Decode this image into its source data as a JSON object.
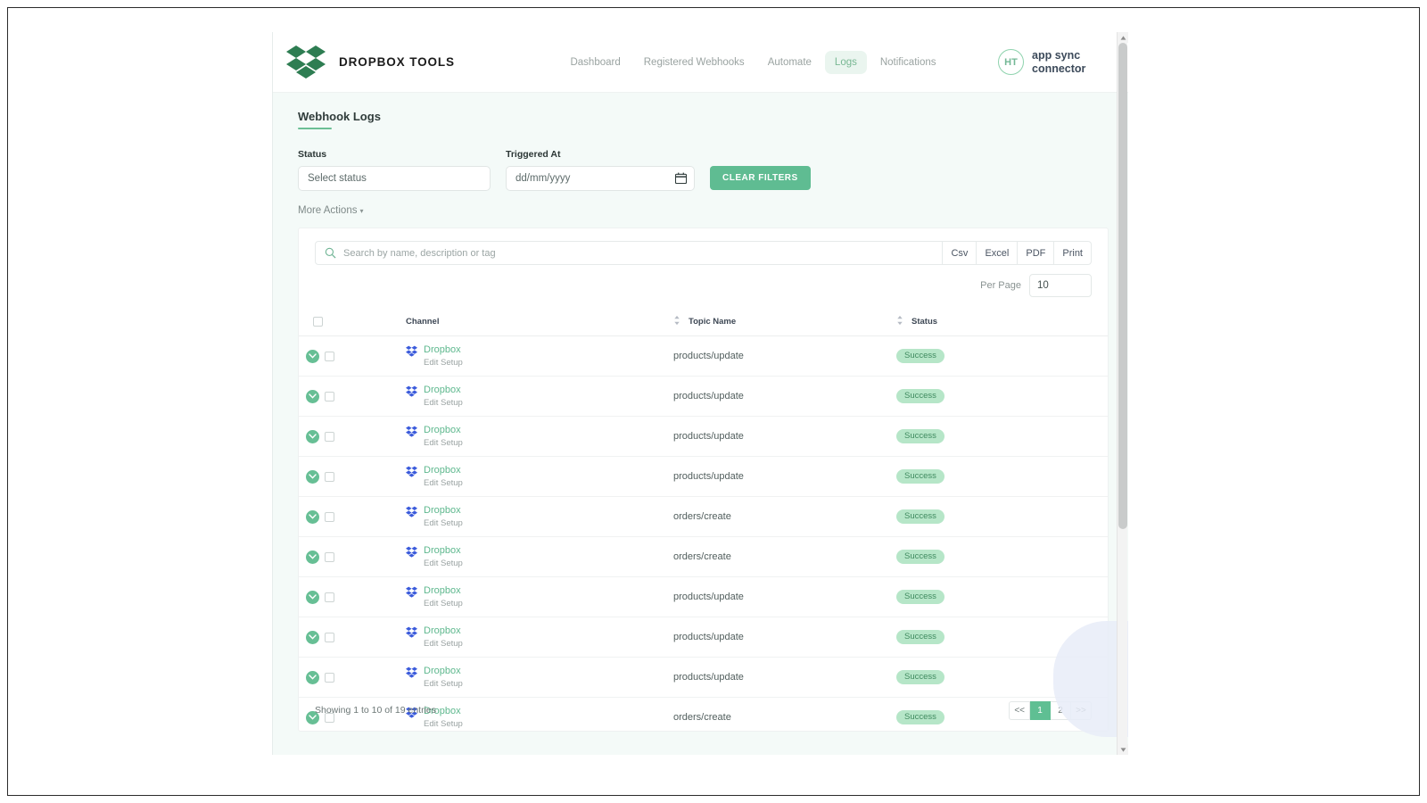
{
  "header": {
    "brand_name": "DROPBOX TOOLS",
    "logo_icon": "dropbox-logo-icon",
    "nav": [
      {
        "label": "Dashboard",
        "active": false
      },
      {
        "label": "Registered Webhooks",
        "active": false
      },
      {
        "label": "Automate",
        "active": false
      },
      {
        "label": "Logs",
        "active": true
      },
      {
        "label": "Notifications",
        "active": false
      }
    ],
    "user": {
      "initials": "HT",
      "name": "app sync connector"
    }
  },
  "page": {
    "title": "Webhook Logs"
  },
  "filters": {
    "status": {
      "label": "Status",
      "value": "",
      "placeholder": "Select status"
    },
    "triggered_at": {
      "label": "Triggered At",
      "value": "",
      "placeholder": "dd/mm/yyyy",
      "icon": "calendar-icon"
    },
    "clear_button": "CLEAR FILTERS",
    "more_actions": "More Actions"
  },
  "toolbar": {
    "search": {
      "value": "",
      "placeholder": "Search by name, description or tag",
      "icon": "search-icon"
    },
    "exports": [
      "Csv",
      "Excel",
      "PDF",
      "Print"
    ],
    "per_page": {
      "label": "Per Page",
      "value": "10"
    }
  },
  "table": {
    "columns": [
      {
        "key": "select",
        "label": ""
      },
      {
        "key": "channel",
        "label": "Channel",
        "sortable": false
      },
      {
        "key": "topic",
        "label": "Topic Name",
        "sortable": true
      },
      {
        "key": "status",
        "label": "Status",
        "sortable": true
      }
    ],
    "rows": [
      {
        "channel": "Dropbox",
        "channel_sub": "Edit Setup",
        "topic": "products/update",
        "status": "Success"
      },
      {
        "channel": "Dropbox",
        "channel_sub": "Edit Setup",
        "topic": "products/update",
        "status": "Success"
      },
      {
        "channel": "Dropbox",
        "channel_sub": "Edit Setup",
        "topic": "products/update",
        "status": "Success"
      },
      {
        "channel": "Dropbox",
        "channel_sub": "Edit Setup",
        "topic": "products/update",
        "status": "Success"
      },
      {
        "channel": "Dropbox",
        "channel_sub": "Edit Setup",
        "topic": "orders/create",
        "status": "Success"
      },
      {
        "channel": "Dropbox",
        "channel_sub": "Edit Setup",
        "topic": "orders/create",
        "status": "Success"
      },
      {
        "channel": "Dropbox",
        "channel_sub": "Edit Setup",
        "topic": "products/update",
        "status": "Success"
      },
      {
        "channel": "Dropbox",
        "channel_sub": "Edit Setup",
        "topic": "products/update",
        "status": "Success"
      },
      {
        "channel": "Dropbox",
        "channel_sub": "Edit Setup",
        "topic": "products/update",
        "status": "Success"
      },
      {
        "channel": "Dropbox",
        "channel_sub": "Edit Setup",
        "topic": "orders/create",
        "status": "Success"
      }
    ]
  },
  "footer": {
    "showing": "Showing 1 to 10 of 19 entries",
    "pages": [
      {
        "label": "<<",
        "active": false
      },
      {
        "label": "1",
        "active": true
      },
      {
        "label": "2",
        "active": false
      },
      {
        "label": ">>",
        "active": false
      }
    ]
  },
  "colors": {
    "accent_green": "#5fbc92",
    "badge_bg": "#b6e6c8",
    "badge_text": "#3f8a5f",
    "link_green": "#5eb88e",
    "nav_active_bg": "#eaf5ef",
    "page_bg": "#f4faf8",
    "dropbox_brand_blue": "#3b5bdb",
    "logo_green": "#2e7d52"
  }
}
